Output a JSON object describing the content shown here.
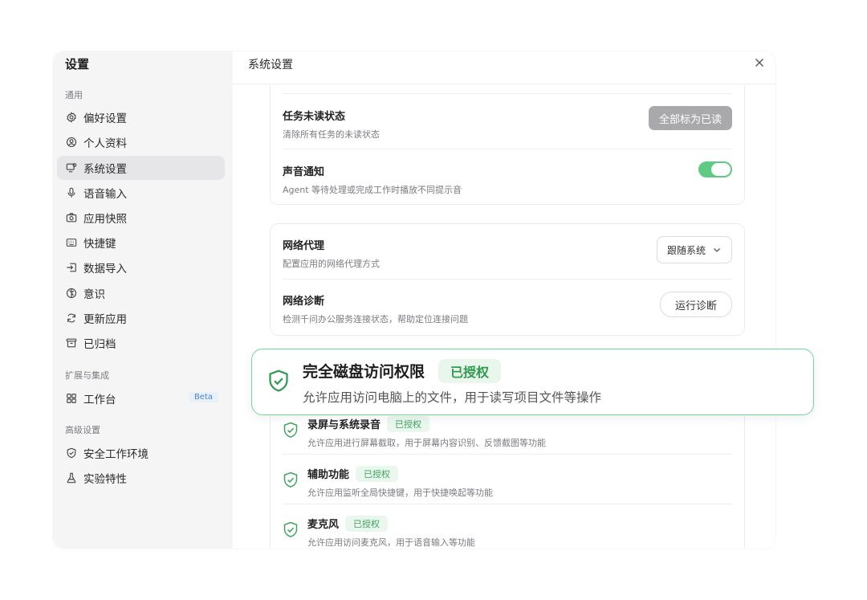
{
  "sidebar": {
    "title": "设置",
    "section_general": "通用",
    "items": [
      {
        "label": "偏好设置",
        "icon": "gear-icon"
      },
      {
        "label": "个人资料",
        "icon": "profile-icon"
      },
      {
        "label": "系统设置",
        "icon": "monitor-settings-icon"
      },
      {
        "label": "语音输入",
        "icon": "microphone-icon"
      },
      {
        "label": "应用快照",
        "icon": "camera-icon"
      },
      {
        "label": "快捷键",
        "icon": "keyboard-icon"
      },
      {
        "label": "数据导入",
        "icon": "import-icon"
      },
      {
        "label": "意识",
        "icon": "brain-icon"
      },
      {
        "label": "更新应用",
        "icon": "refresh-icon"
      },
      {
        "label": "已归档",
        "icon": "archive-icon"
      }
    ],
    "section_extensions": "扩展与集成",
    "workbench": {
      "label": "工作台",
      "badge": "Beta",
      "icon": "grid-icon"
    },
    "section_advanced": "高级设置",
    "advanced_items": [
      {
        "label": "安全工作环境",
        "icon": "shield-icon"
      },
      {
        "label": "实验特性",
        "icon": "flask-icon"
      }
    ]
  },
  "main": {
    "title": "系统设置",
    "notifications": {
      "unread_title": "任务未读状态",
      "unread_desc": "清除所有任务的未读状态",
      "unread_button": "全部标为已读",
      "sound_title": "声音通知",
      "sound_desc": "Agent 等待处理或完成工作时播放不同提示音",
      "sound_enabled": true
    },
    "network": {
      "proxy_title": "网络代理",
      "proxy_desc": "配置应用的网络代理方式",
      "proxy_value": "跟随系统",
      "diag_title": "网络诊断",
      "diag_desc": "检测千问办公服务连接状态，帮助定位连接问题",
      "diag_button": "运行诊断"
    },
    "permissions": [
      {
        "title": "录屏与系统录音",
        "badge": "已授权",
        "desc": "允许应用进行屏幕截取，用于屏幕内容识别、反馈截图等功能"
      },
      {
        "title": "辅助功能",
        "badge": "已授权",
        "desc": "允许应用监听全局快捷键，用于快捷唤起等功能"
      },
      {
        "title": "麦克风",
        "badge": "已授权",
        "desc": "允许应用访问麦克风，用于语音输入等功能"
      }
    ]
  },
  "highlight": {
    "title": "完全磁盘访问权限",
    "badge": "已授权",
    "desc": "允许应用访问电脑上的文件，用于读写项目文件等操作"
  },
  "colors": {
    "accent_green": "#5fcb82",
    "badge_green_text": "#3ea35d",
    "sidebar_bg": "#f5f5f6"
  }
}
